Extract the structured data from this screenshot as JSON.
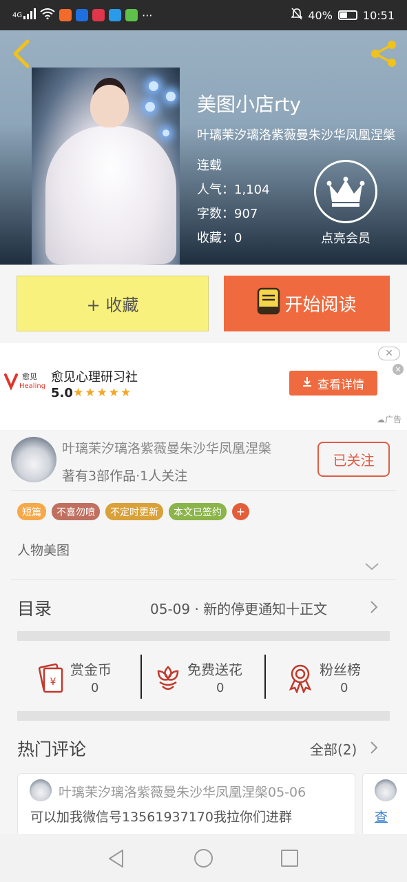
{
  "status_bar": {
    "network": "4G",
    "battery": "40%",
    "time": "10:51",
    "more": "···",
    "apps": [
      {
        "icon": "app-orange-icon",
        "color": "#f26b2a"
      },
      {
        "icon": "app-quan-icon",
        "color": "#1f6fe0"
      },
      {
        "icon": "app-red-icon",
        "color": "#e0354a"
      },
      {
        "icon": "app-blue-icon",
        "color": "#2a9be8"
      },
      {
        "icon": "app-green-icon",
        "color": "#5cc24a"
      }
    ]
  },
  "book": {
    "title": "美图小店rty",
    "author_line": "叶璃茉汐璃洛紫薇曼朱沙华凤凰涅槃",
    "status": "连载",
    "popularity": "人气：1,104",
    "word_count": "字数：907",
    "favorites": "收藏：0"
  },
  "vip": {
    "label": "点亮会员"
  },
  "actions": {
    "favorite_label": "+ 收藏",
    "read_label": "开始阅读"
  },
  "ad": {
    "name": "愈见心理研习社",
    "rating": "5.0",
    "stars": "★★★★★",
    "button_label": "查看详情",
    "tag": "广告",
    "logo_text": "愈见",
    "logo_sub": "Healing"
  },
  "author": {
    "name": "叶璃茉汐璃洛紫薇曼朱沙华凤凰涅槃",
    "info": "著有3部作品·1人关注",
    "follow_label": "已关注"
  },
  "tags": [
    {
      "label": "短篇",
      "color": "#f6a94a"
    },
    {
      "label": "不喜勿喷",
      "color": "#c07060"
    },
    {
      "label": "不定时更新",
      "color": "#d9a13a"
    },
    {
      "label": "本文已签约",
      "color": "#8bb44a"
    }
  ],
  "tag_add": "+",
  "category": "人物美图",
  "toc": {
    "label": "目录",
    "latest": "05-09 · 新的停更通知十正文"
  },
  "stats": [
    {
      "label": "赏金币",
      "value": "0",
      "icon": "red-envelope-icon"
    },
    {
      "label": "免费送花",
      "value": "0",
      "icon": "flower-icon"
    },
    {
      "label": "粉丝榜",
      "value": "0",
      "icon": "medal-icon"
    }
  ],
  "hot_comments": {
    "title": "热门评论",
    "all_label": "全部(2)",
    "items": [
      {
        "name": "叶璃茉汐璃洛紫薇曼朱沙华凤凰涅槃05-06",
        "text": "可以加我微信号13561937170我拉你们进群"
      },
      {
        "name": "",
        "text": "查"
      }
    ]
  }
}
